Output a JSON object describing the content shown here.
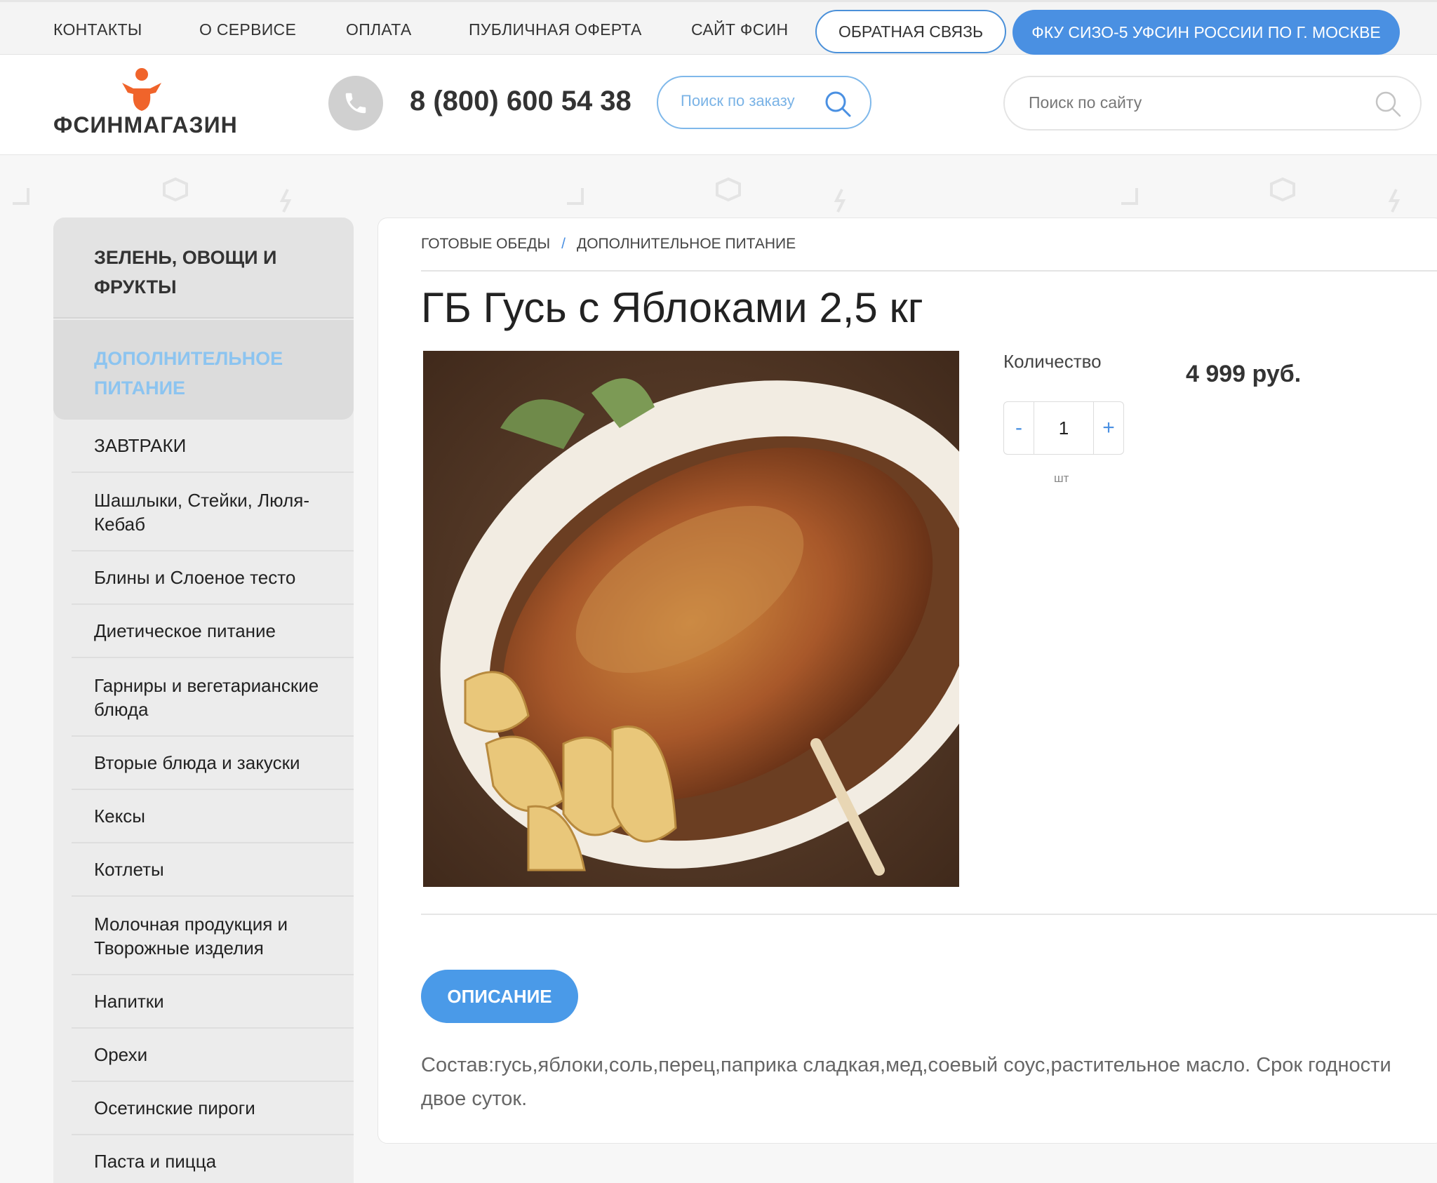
{
  "topnav": {
    "links": [
      "КОНТАКТЫ",
      "О СЕРВИСЕ",
      "ОПЛАТА",
      "ПУБЛИЧНАЯ ОФЕРТА",
      "САЙТ ФСИН"
    ],
    "feedback": "ОБРАТНАЯ СВЯЗЬ",
    "institution": "ФКУ СИЗО-5 УФСИН РОССИИ ПО Г. МОСКВЕ"
  },
  "header": {
    "logo_text": "ФСИНМАГАЗИН",
    "phone": "8 (800) 600 54 38",
    "order_search_placeholder": "Поиск по заказу",
    "site_search_placeholder": "Поиск по сайту"
  },
  "sidebar": {
    "head": "ЗЕЛЕНЬ, ОВОЩИ И ФРУКТЫ",
    "active": "ДОПОЛНИТЕЛЬНОЕ ПИТАНИЕ",
    "items": [
      "ЗАВТРАКИ",
      "Шашлыки, Стейки, Люля-Кебаб",
      "Блины и Слоеное тесто",
      "Диетическое питание",
      "Гарниры и вегетарианские блюда",
      "Вторые блюда и закуски",
      "Кексы",
      "Котлеты",
      "Молочная продукция и Творожные изделия",
      "Напитки",
      "Орехи",
      "Осетинские пироги",
      "Паста и пицца"
    ]
  },
  "breadcrumb": {
    "first": "ГОТОВЫЕ ОБЕДЫ",
    "separator": "/",
    "second": "ДОПОЛНИТЕЛЬНОЕ ПИТАНИЕ"
  },
  "product": {
    "title": "ГБ Гусь с Яблоками 2,5 кг",
    "quantity_label": "Количество",
    "price": "4 999 руб.",
    "minus": "-",
    "quantity": "1",
    "plus": "+",
    "unit": "шт",
    "description_tab": "ОПИСАНИЕ",
    "description": "Состав:гусь,яблоки,соль,перец,паприка сладкая,мед,соевый соус,растительное масло. Срок годности двое суток."
  },
  "colors": {
    "accent": "#4a90e2",
    "active_category": "#8cc4f0",
    "logo_orange": "#f0642b"
  }
}
